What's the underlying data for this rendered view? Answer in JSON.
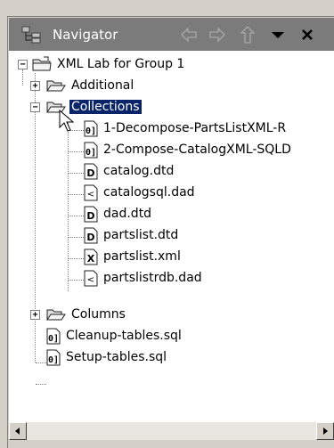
{
  "view": {
    "title": "Navigator",
    "icon": "navigator-view-icon",
    "toolbar": [
      "back-arrow-icon",
      "forward-arrow-icon",
      "up-arrow-icon",
      "view-menu-icon",
      "close-icon"
    ]
  },
  "tree": {
    "root": {
      "label": "XML Lab for Group 1",
      "icon": "project-folder-icon",
      "expanded": true
    },
    "items": [
      {
        "label": "Additional",
        "type": "folder",
        "expanded": false
      },
      {
        "label": "Collections",
        "type": "folder",
        "expanded": true,
        "selected": true,
        "children": [
          {
            "label": "1-Decompose-PartsListXML-R",
            "type": "sql-file"
          },
          {
            "label": "2-Compose-CatalogXML-SQLD",
            "type": "sql-file"
          },
          {
            "label": "catalog.dtd",
            "type": "dtd-file"
          },
          {
            "label": "catalogsql.dad",
            "type": "dad-file"
          },
          {
            "label": "dad.dtd",
            "type": "dtd-file"
          },
          {
            "label": "partslist.dtd",
            "type": "dtd-file"
          },
          {
            "label": "partslist.xml",
            "type": "xml-file"
          },
          {
            "label": "partslistrdb.dad",
            "type": "dad-file"
          }
        ]
      },
      {
        "label": "Columns",
        "type": "folder",
        "expanded": false
      },
      {
        "label": "Cleanup-tables.sql",
        "type": "sql-file"
      },
      {
        "label": "Setup-tables.sql",
        "type": "sql-file"
      }
    ]
  },
  "glyphs": {
    "expand": "+",
    "collapse": "−"
  },
  "colors": {
    "titlebar": "#7b7b7b",
    "selection": "#0a246a",
    "window": "#d4d0c8"
  }
}
